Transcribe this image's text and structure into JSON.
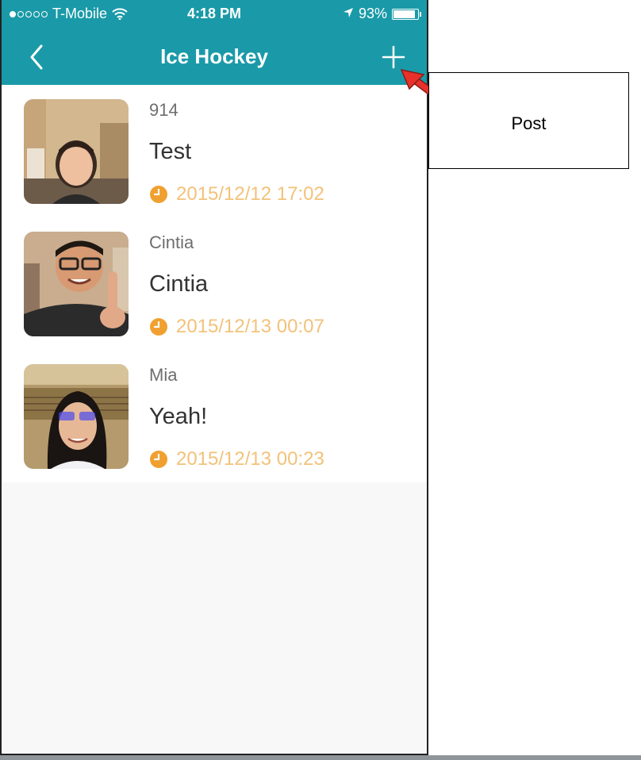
{
  "colors": {
    "header": "#1a9aa8",
    "accent": "#f0a030",
    "timestamp_text": "#f2c27a",
    "annotation_arrow": "#e8312a"
  },
  "status_bar": {
    "carrier": "T-Mobile",
    "time": "4:18 PM",
    "battery": "93%",
    "battery_level": 0.93,
    "signal_bars": 1,
    "signal_total": 5
  },
  "nav": {
    "title": "Ice Hockey",
    "back_icon": "chevron-left-icon",
    "add_icon": "plus-icon"
  },
  "posts": [
    {
      "author": "914",
      "message": "Test",
      "timestamp": "2015/12/12 17:02"
    },
    {
      "author": "Cintia",
      "message": "Cintia",
      "timestamp": "2015/12/13 00:07"
    },
    {
      "author": "Mia",
      "message": "Yeah!",
      "timestamp": "2015/12/13 00:23"
    }
  ],
  "annotation": {
    "label": "Post"
  }
}
